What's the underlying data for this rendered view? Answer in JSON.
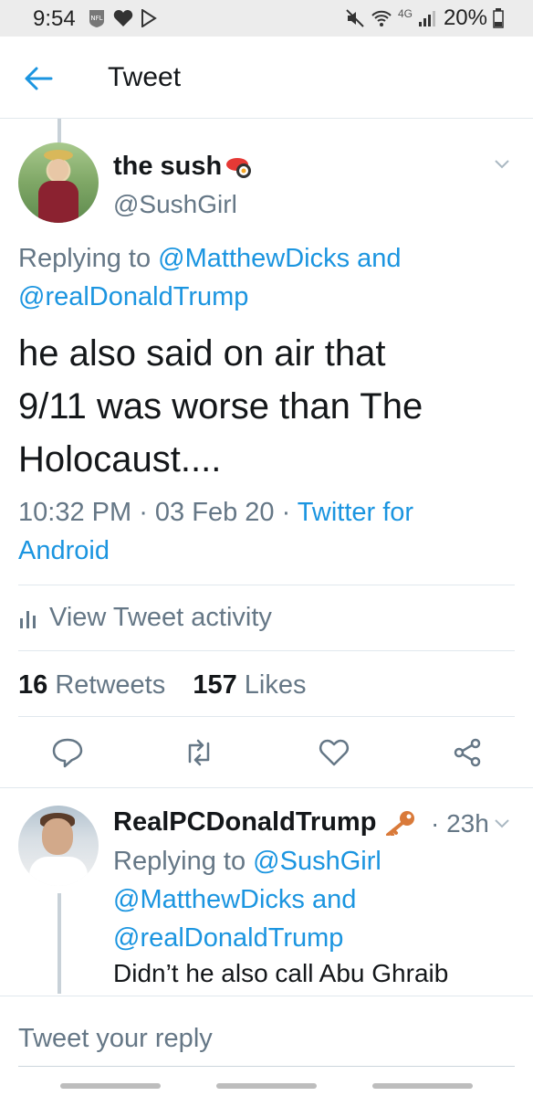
{
  "status_bar": {
    "time": "9:54",
    "network": "4G",
    "battery": "20%"
  },
  "header": {
    "title": "Tweet"
  },
  "main_tweet": {
    "display_name": "the sush",
    "handle": "@SushGirl",
    "replying_prefix": "Replying to ",
    "mention_1": "@MatthewDicks",
    "and_word": " and ",
    "mention_2": "@realDonaldTrump",
    "text_line1": "he also said on air that",
    "text_line2": "9/11 was worse than The",
    "text_line3": "Holocaust....",
    "time": "10:32 PM",
    "date": "03 Feb 20",
    "source_line1": "Twitter for",
    "source_line2": "Android",
    "dot": " · ",
    "activity_label": "View Tweet activity",
    "retweets_count": "16",
    "retweets_label": "Retweets",
    "likes_count": "157",
    "likes_label": "Likes"
  },
  "reply_tweet": {
    "display_name": "RealPCDonaldTrump",
    "time": "23h",
    "replying_prefix": "Replying to ",
    "mention_1": "@SushGirl",
    "mention_2": "@MatthewDicks",
    "and_word": " and",
    "mention_3": "@realDonaldTrump",
    "text": "Didn’t he also call Abu Ghraib"
  },
  "compose": {
    "placeholder": "Tweet your reply"
  },
  "colors": {
    "accent": "#1b95e0",
    "secondary_text": "#657786",
    "primary_text": "#14171a",
    "divider": "#e1e8ed"
  },
  "icons": {
    "back": "arrow-left-icon",
    "menu": "chevron-down-icon",
    "reply": "reply-icon",
    "retweet": "retweet-icon",
    "like": "heart-icon",
    "share": "share-icon",
    "activity": "bar-chart-icon",
    "name_emoji": "sushi-emoji",
    "reply_name_emoji": "key-emoji"
  }
}
